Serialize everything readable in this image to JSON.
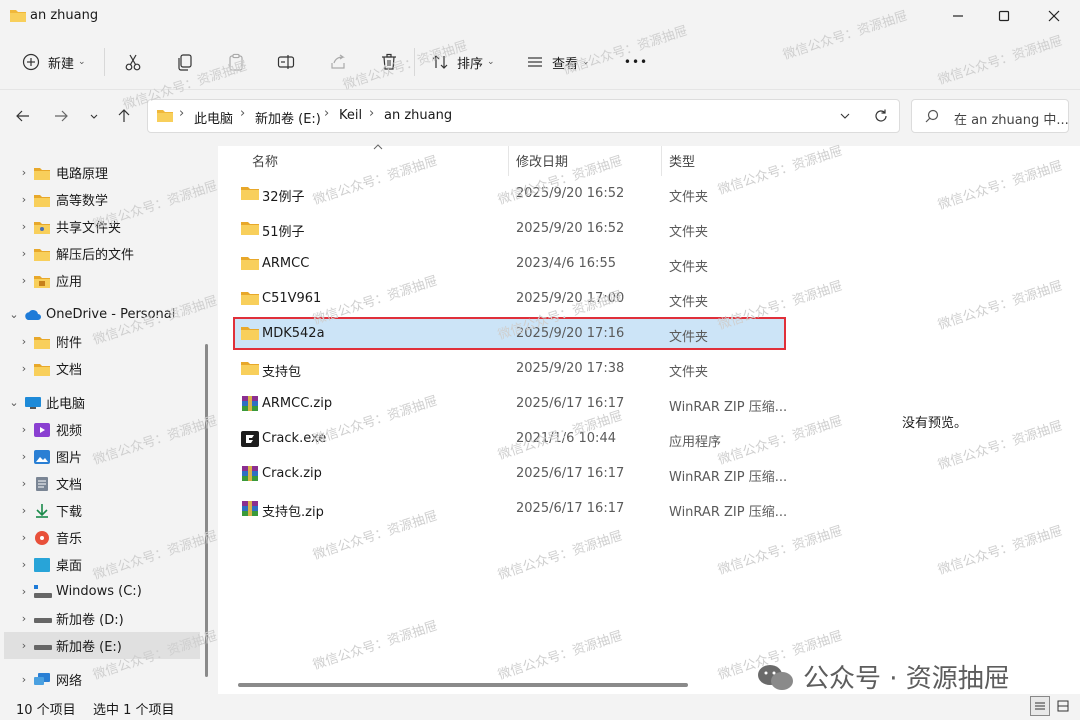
{
  "window": {
    "title": "an zhuang"
  },
  "toolbar": {
    "new_label": "新建",
    "sort_label": "排序",
    "view_label": "查看",
    "more_label": "•••"
  },
  "address": {
    "crumbs": [
      "此电脑",
      "新加卷 (E:)",
      "Keil",
      "an zhuang"
    ],
    "search_placeholder": "在 an zhuang 中..."
  },
  "nav": {
    "items": [
      {
        "label": "电路原理"
      },
      {
        "label": "高等数学"
      },
      {
        "label": "共享文件夹"
      },
      {
        "label": "解压后的文件"
      },
      {
        "label": "应用"
      },
      {
        "label": "OneDrive - Personal"
      },
      {
        "label": "附件"
      },
      {
        "label": "文档"
      },
      {
        "label": "此电脑"
      },
      {
        "label": "视频"
      },
      {
        "label": "图片"
      },
      {
        "label": "文档"
      },
      {
        "label": "下载"
      },
      {
        "label": "音乐"
      },
      {
        "label": "桌面"
      },
      {
        "label": "Windows (C:)"
      },
      {
        "label": "新加卷 (D:)"
      },
      {
        "label": "新加卷 (E:)"
      },
      {
        "label": "网络"
      }
    ]
  },
  "columns": {
    "name": "名称",
    "modified": "修改日期",
    "type": "类型"
  },
  "files": [
    {
      "name": "32例子",
      "modified": "2025/9/20 16:52",
      "type": "文件夹",
      "kind": "folder"
    },
    {
      "name": "51例子",
      "modified": "2025/9/20 16:52",
      "type": "文件夹",
      "kind": "folder"
    },
    {
      "name": "ARMCC",
      "modified": "2023/4/6 16:55",
      "type": "文件夹",
      "kind": "folder"
    },
    {
      "name": "C51V961",
      "modified": "2025/9/20 17:00",
      "type": "文件夹",
      "kind": "folder"
    },
    {
      "name": "MDK542a",
      "modified": "2025/9/20 17:16",
      "type": "文件夹",
      "kind": "folder",
      "selected": true
    },
    {
      "name": "支持包",
      "modified": "2025/9/20 17:38",
      "type": "文件夹",
      "kind": "folder"
    },
    {
      "name": "ARMCC.zip",
      "modified": "2025/6/17 16:17",
      "type": "WinRAR ZIP 压缩...",
      "kind": "zip"
    },
    {
      "name": "Crack.exe",
      "modified": "2021/1/6 10:44",
      "type": "应用程序",
      "kind": "exe"
    },
    {
      "name": "Crack.zip",
      "modified": "2025/6/17 16:17",
      "type": "WinRAR ZIP 压缩...",
      "kind": "zip"
    },
    {
      "name": "支持包.zip",
      "modified": "2025/6/17 16:17",
      "type": "WinRAR ZIP 压缩...",
      "kind": "zip"
    }
  ],
  "preview": {
    "text": "没有预览。"
  },
  "status": {
    "count": "10 个项目",
    "selected": "选中 1 个项目"
  },
  "watermark": {
    "text": "微信公众号：资源抽屉",
    "brand": "公众号 · 资源抽屉"
  }
}
